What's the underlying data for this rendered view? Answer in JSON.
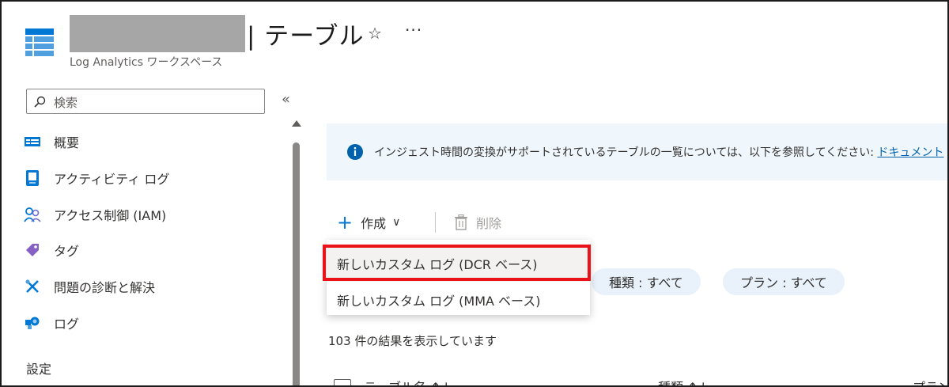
{
  "header": {
    "title": "| テーブル",
    "subtitle": "Log Analytics ワークスペース",
    "more_label": "···"
  },
  "sidebar": {
    "search_placeholder": "検索",
    "collapse_label": "«",
    "items": [
      {
        "label": "概要",
        "icon": "overview-icon"
      },
      {
        "label": "アクティビティ ログ",
        "icon": "activity-log-icon"
      },
      {
        "label": "アクセス制御 (IAM)",
        "icon": "access-control-icon"
      },
      {
        "label": "タグ",
        "icon": "tag-icon"
      },
      {
        "label": "問題の診断と解決",
        "icon": "diagnose-icon"
      },
      {
        "label": "ログ",
        "icon": "logs-icon"
      }
    ],
    "section_label": "設定"
  },
  "banner": {
    "text": "インジェスト時間の変換がサポートされているテーブルの一覧については、以下を参照してください:",
    "link": "ドキュメント"
  },
  "toolbar": {
    "create_label": "作成",
    "delete_label": "削除"
  },
  "dropdown": {
    "items": [
      "新しいカスタム ログ (DCR ベース)",
      "新しいカスタム ログ (MMA ベース)"
    ]
  },
  "filters": {
    "type": "種類 : すべて",
    "plan": "プラン : すべて"
  },
  "results": {
    "count_text": "103 件の結果を表示しています"
  },
  "table": {
    "columns": [
      "テーブル名 ↑↓",
      "種類 ↑↓",
      "プラン"
    ]
  },
  "colors": {
    "accent": "#0078d4",
    "highlight": "#e8141a",
    "banner_bg": "#eff6fc"
  }
}
